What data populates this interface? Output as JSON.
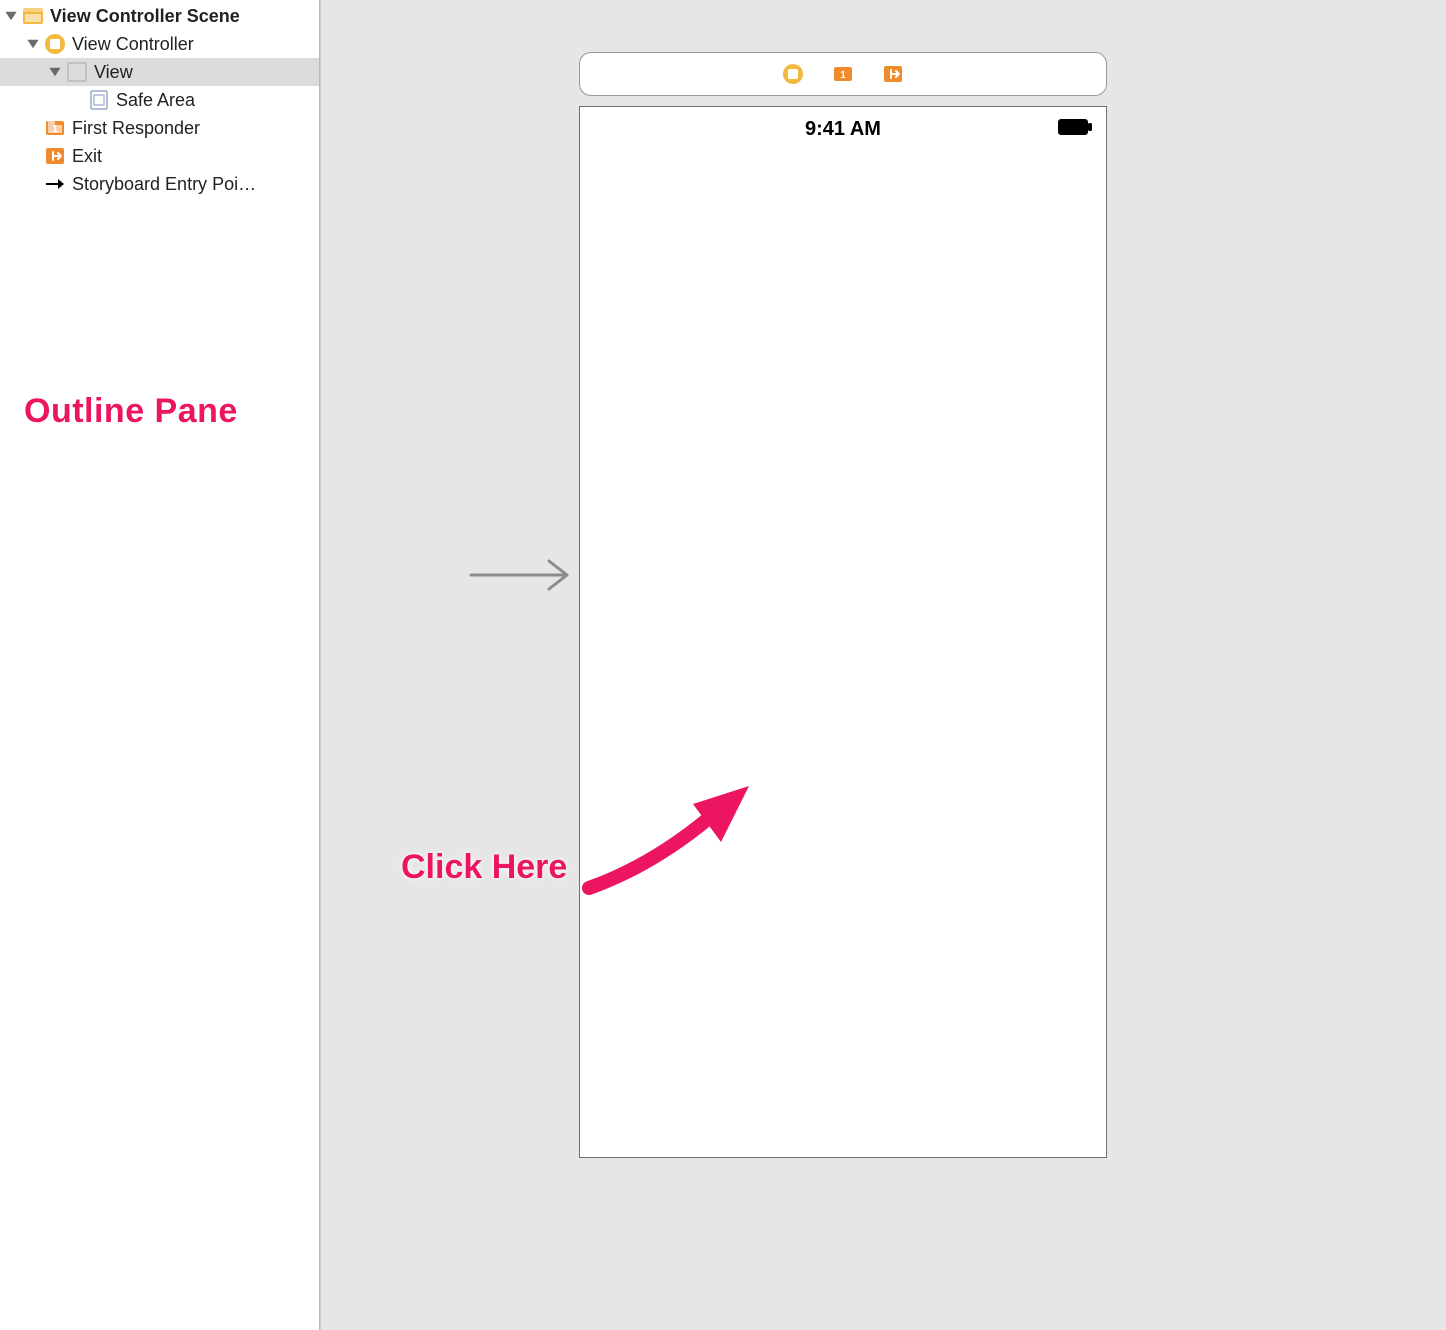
{
  "outline": {
    "items": [
      {
        "label": "View Controller Scene",
        "indent": 0,
        "icon": "scene",
        "disclosure": true,
        "root": true,
        "selected": false
      },
      {
        "label": "View Controller",
        "indent": 1,
        "icon": "viewcontroller",
        "disclosure": true,
        "root": false,
        "selected": false
      },
      {
        "label": "View",
        "indent": 2,
        "icon": "view",
        "disclosure": true,
        "root": false,
        "selected": true
      },
      {
        "label": "Safe Area",
        "indent": 3,
        "icon": "safearea",
        "disclosure": false,
        "root": false,
        "selected": false
      },
      {
        "label": "First Responder",
        "indent": 1,
        "icon": "firstresponder",
        "disclosure": false,
        "root": false,
        "selected": false
      },
      {
        "label": "Exit",
        "indent": 1,
        "icon": "exit",
        "disclosure": false,
        "root": false,
        "selected": false
      },
      {
        "label": "Storyboard Entry Poi…",
        "indent": 1,
        "icon": "entrypoint",
        "disclosure": false,
        "root": false,
        "selected": false
      }
    ]
  },
  "annotations": {
    "outline_label": "Outline Pane",
    "click_label": "Click Here"
  },
  "device": {
    "status_time": "9:41 AM"
  },
  "colors": {
    "accent_orange": "#f08b2d",
    "accent_yellow": "#f3b93e",
    "annotation_pink": "#ec1561"
  }
}
